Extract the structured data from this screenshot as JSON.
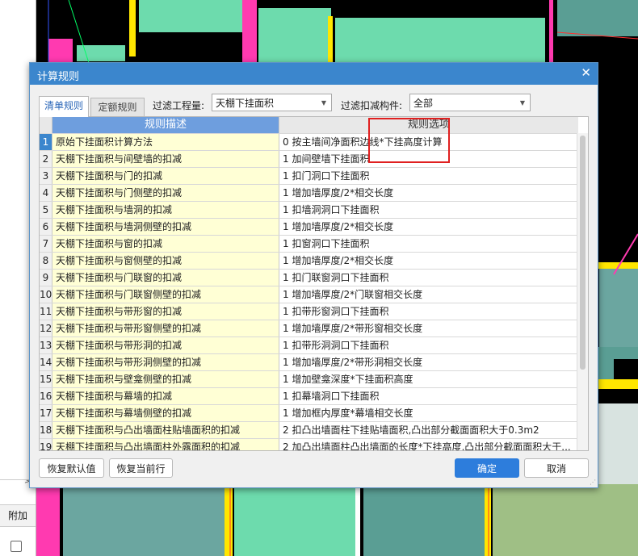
{
  "background": {
    "side_panel_label": "附加"
  },
  "dialog": {
    "title": "计算规则",
    "close_glyph": "✕",
    "tabs": [
      {
        "label": "清单规则",
        "active": true
      },
      {
        "label": "定额规则",
        "active": false
      }
    ],
    "filter_quantity": {
      "label": "过滤工程量:",
      "value": "天棚下挂面积"
    },
    "filter_member": {
      "label": "过滤扣减构件:",
      "value": "全部"
    },
    "grid": {
      "col_desc": "规则描述",
      "col_option": "规则选项",
      "rows": [
        {
          "num": "1",
          "desc": "原始下挂面积计算方法",
          "option": "0 按主墙间净面积边线*下挂高度计算"
        },
        {
          "num": "2",
          "desc": "天棚下挂面积与间壁墙的扣减",
          "option": "1 加间壁墙下挂面积"
        },
        {
          "num": "3",
          "desc": "天棚下挂面积与门的扣减",
          "option": "1 扣门洞口下挂面积"
        },
        {
          "num": "4",
          "desc": "天棚下挂面积与门侧壁的扣减",
          "option": "1 增加墙厚度/2*相交长度"
        },
        {
          "num": "5",
          "desc": "天棚下挂面积与墙洞的扣减",
          "option": "1 扣墙洞洞口下挂面积"
        },
        {
          "num": "6",
          "desc": "天棚下挂面积与墙洞侧壁的扣减",
          "option": "1 增加墙厚度/2*相交长度"
        },
        {
          "num": "7",
          "desc": "天棚下挂面积与窗的扣减",
          "option": "1 扣窗洞口下挂面积"
        },
        {
          "num": "8",
          "desc": "天棚下挂面积与窗侧壁的扣减",
          "option": "1 增加墙厚度/2*相交长度"
        },
        {
          "num": "9",
          "desc": "天棚下挂面积与门联窗的扣减",
          "option": "1 扣门联窗洞口下挂面积"
        },
        {
          "num": "10",
          "desc": "天棚下挂面积与门联窗侧壁的扣减",
          "option": "1 增加墙厚度/2*门联窗相交长度"
        },
        {
          "num": "11",
          "desc": "天棚下挂面积与带形窗的扣减",
          "option": "1 扣带形窗洞口下挂面积"
        },
        {
          "num": "12",
          "desc": "天棚下挂面积与带形窗侧壁的扣减",
          "option": "1 增加墙厚度/2*带形窗相交长度"
        },
        {
          "num": "13",
          "desc": "天棚下挂面积与带形洞的扣减",
          "option": "1 扣带形洞洞口下挂面积"
        },
        {
          "num": "14",
          "desc": "天棚下挂面积与带形洞侧壁的扣减",
          "option": "1 增加墙厚度/2*带形洞相交长度"
        },
        {
          "num": "15",
          "desc": "天棚下挂面积与壁龛侧壁的扣减",
          "option": "1 增加壁龛深度*下挂面积高度"
        },
        {
          "num": "16",
          "desc": "天棚下挂面积与幕墙的扣减",
          "option": "1 扣幕墙洞口下挂面积"
        },
        {
          "num": "17",
          "desc": "天棚下挂面积与幕墙侧壁的扣减",
          "option": "1 增加框内厚度*幕墙相交长度"
        },
        {
          "num": "18",
          "desc": "天棚下挂面积与凸出墙面柱贴墙面积的扣减",
          "option": "2 扣凸出墙面柱下挂贴墙面积,凸出部分截面面积大于0.3m2"
        },
        {
          "num": "19",
          "desc": "天棚下挂面积与凸出墙面柱外露面积的扣减",
          "option": "2 加凸出墙面柱凸出墙面的长度*下挂高度,凸出部分截面面积大于..."
        }
      ]
    },
    "buttons": {
      "reset_default": "恢复默认值",
      "reset_row": "恢复当前行",
      "ok": "确定",
      "cancel": "取消"
    }
  },
  "colors": {
    "title_bar": "#3b86cd",
    "header_active": "#6e9ede",
    "desc_cell": "#ffffd5",
    "ok_button": "#2d7ddc",
    "annotation_box": "#e02020"
  }
}
